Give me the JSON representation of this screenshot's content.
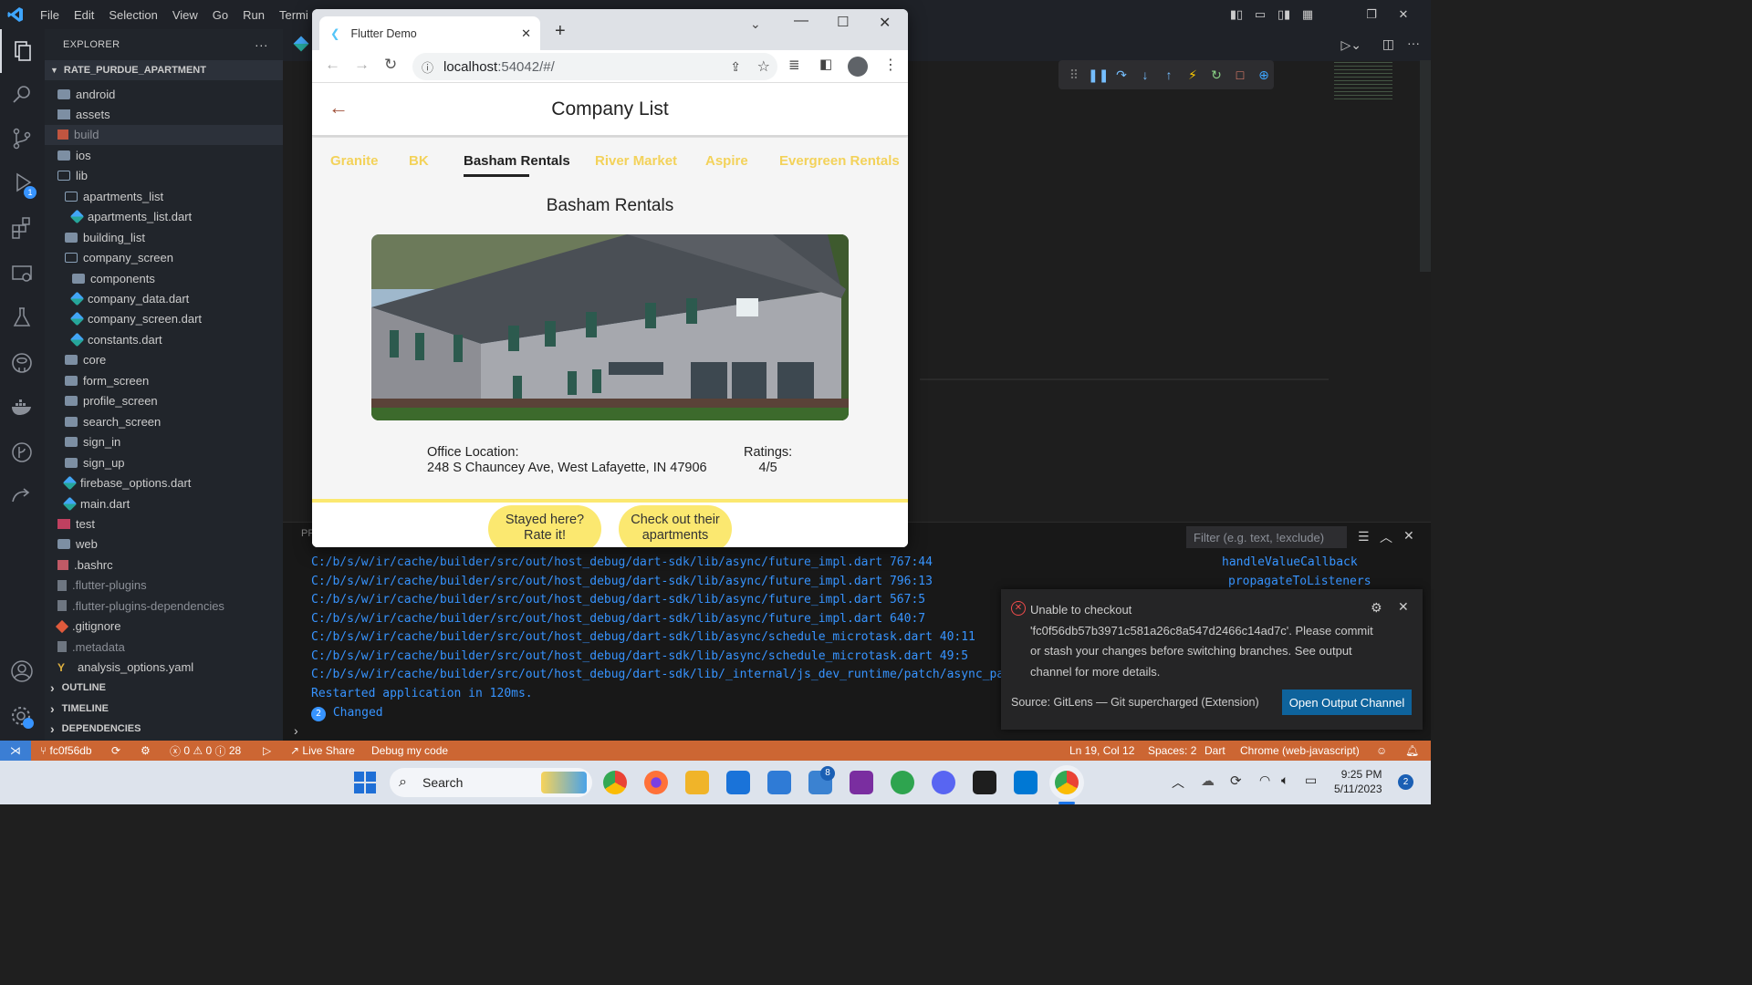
{
  "vscode": {
    "menu": [
      "File",
      "Edit",
      "Selection",
      "View",
      "Go",
      "Run",
      "Termi"
    ],
    "explorer_title": "EXPLORER",
    "project": "RATE_PURDUE_APARTMENT",
    "tree": [
      {
        "label": "android",
        "kind": "folderfill",
        "depth": 0
      },
      {
        "label": "assets",
        "kind": "assets",
        "depth": 0
      },
      {
        "label": "build",
        "kind": "build",
        "depth": 0
      },
      {
        "label": "ios",
        "kind": "folderfill",
        "depth": 0
      },
      {
        "label": "lib",
        "kind": "folder",
        "depth": 0
      },
      {
        "label": "apartments_list",
        "kind": "folder",
        "depth": 1
      },
      {
        "label": "apartments_list.dart",
        "kind": "dart",
        "depth": 2
      },
      {
        "label": "building_list",
        "kind": "folderfill",
        "depth": 1
      },
      {
        "label": "company_screen",
        "kind": "folder",
        "depth": 1
      },
      {
        "label": "components",
        "kind": "folderfill",
        "depth": 2
      },
      {
        "label": "company_data.dart",
        "kind": "dart",
        "depth": 2
      },
      {
        "label": "company_screen.dart",
        "kind": "dart",
        "depth": 2
      },
      {
        "label": "constants.dart",
        "kind": "dart",
        "depth": 2
      },
      {
        "label": "core",
        "kind": "folderfill",
        "depth": 1
      },
      {
        "label": "form_screen",
        "kind": "folderfill",
        "depth": 1
      },
      {
        "label": "profile_screen",
        "kind": "folderfill",
        "depth": 1
      },
      {
        "label": "search_screen",
        "kind": "folderfill",
        "depth": 1
      },
      {
        "label": "sign_in",
        "kind": "folderfill",
        "depth": 1
      },
      {
        "label": "sign_up",
        "kind": "folderfill",
        "depth": 1
      },
      {
        "label": "firebase_options.dart",
        "kind": "dart",
        "depth": 1
      },
      {
        "label": "main.dart",
        "kind": "dart",
        "depth": 1
      },
      {
        "label": "test",
        "kind": "test",
        "depth": 0
      },
      {
        "label": "web",
        "kind": "folderfill",
        "depth": 0
      },
      {
        "label": ".bashrc",
        "kind": "bash",
        "depth": 0
      },
      {
        "label": ".flutter-plugins",
        "kind": "file",
        "depth": 0
      },
      {
        "label": ".flutter-plugins-dependencies",
        "kind": "file",
        "depth": 0
      },
      {
        "label": ".gitignore",
        "kind": "git",
        "depth": 0
      },
      {
        "label": ".metadata",
        "kind": "file",
        "depth": 0
      },
      {
        "label": "analysis_options.yaml",
        "kind": "yaml",
        "depth": 0
      }
    ],
    "sections": [
      "OUTLINE",
      "TIMELINE",
      "DEPENDENCIES"
    ],
    "panel_tab": "PF",
    "filter_placeholder": "Filter (e.g. text, !exclude)",
    "log": [
      "C:/b/s/w/ir/cache/builder/src/out/host_debug/dart-sdk/lib/async/future_impl.dart 767:44",
      "C:/b/s/w/ir/cache/builder/src/out/host_debug/dart-sdk/lib/async/future_impl.dart 796:13",
      "C:/b/s/w/ir/cache/builder/src/out/host_debug/dart-sdk/lib/async/future_impl.dart 567:5",
      "C:/b/s/w/ir/cache/builder/src/out/host_debug/dart-sdk/lib/async/future_impl.dart 640:7",
      "C:/b/s/w/ir/cache/builder/src/out/host_debug/dart-sdk/lib/async/schedule_microtask.dart 40:11",
      "C:/b/s/w/ir/cache/builder/src/out/host_debug/dart-sdk/lib/async/schedule_microtask.dart 49:5",
      "C:/b/s/w/ir/cache/builder/src/out/host_debug/dart-sdk/lib/_internal/js_dev_runtime/patch/async_pa",
      "Restarted application in 120ms."
    ],
    "log_right": [
      "handleValueCallback",
      "propagateToListeners"
    ],
    "changed_count": "2",
    "changed_label": "Changed",
    "status": {
      "branch": "fc0f56db",
      "problems": "0",
      "warnings": "0",
      "info": "28",
      "live_share": "Live Share",
      "debug": "Debug my code",
      "position": "Ln 19, Col 12",
      "spaces": "Spaces: 2",
      "language": "Dart",
      "device": "Chrome (web-javascript)"
    },
    "debug_badge": "1",
    "toast": {
      "message": "Unable to checkout 'fc0f56db57b3971c581a26c8a547d2466c14ad7c'. Please commit or stash your changes before switching branches. See output channel for more details.",
      "source": "Source: GitLens — Git supercharged (Extension)",
      "button": "Open Output Channel"
    }
  },
  "chrome": {
    "tab_title": "Flutter Demo",
    "url_host": "localhost",
    "url_rest": ":54042/#/"
  },
  "app": {
    "appbar_title": "Company List",
    "tabs": [
      "Granite",
      "BK",
      "Basham Rentals",
      "River Market",
      "Aspire",
      "Evergreen Rentals"
    ],
    "selected_tab": "Basham Rentals",
    "company_name": "Basham Rentals",
    "office_label": "Office Location:",
    "office_address": "248 S Chauncey Ave, West Lafayette, IN 47906",
    "ratings_label": "Ratings:",
    "ratings_value": "4/5",
    "button_rate": "Stayed here? Rate it!",
    "button_rate_l1": "Stayed here?",
    "button_rate_l2": "Rate it!",
    "button_apts_l1": "Check out their",
    "button_apts_l2": "apartments",
    "accent_color": "#fbe870",
    "tab_text_color": "#f3d25a"
  },
  "taskbar": {
    "search": "Search",
    "time": "9:25 PM",
    "date": "5/11/2023",
    "todo_badge": "8",
    "notif_badge": "2"
  }
}
